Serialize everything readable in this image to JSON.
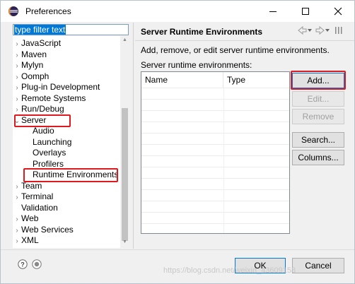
{
  "window": {
    "title": "Preferences",
    "app_icon": "eclipse-icon",
    "controls": [
      "minimize-icon",
      "maximize-icon",
      "close-icon"
    ]
  },
  "filter": {
    "value": "type filter text"
  },
  "tree": {
    "items": [
      {
        "label": "JavaScript",
        "arrow": "›",
        "indent": 0
      },
      {
        "label": "Maven",
        "arrow": "›",
        "indent": 0
      },
      {
        "label": "Mylyn",
        "arrow": "›",
        "indent": 0
      },
      {
        "label": "Oomph",
        "arrow": "›",
        "indent": 0
      },
      {
        "label": "Plug-in Development",
        "arrow": "›",
        "indent": 0
      },
      {
        "label": "Remote Systems",
        "arrow": "›",
        "indent": 0
      },
      {
        "label": "Run/Debug",
        "arrow": "›",
        "indent": 0
      },
      {
        "label": "Server",
        "arrow": "⌄",
        "indent": 0
      },
      {
        "label": "Audio",
        "arrow": "",
        "indent": 1
      },
      {
        "label": "Launching",
        "arrow": "",
        "indent": 1
      },
      {
        "label": "Overlays",
        "arrow": "",
        "indent": 1
      },
      {
        "label": "Profilers",
        "arrow": "",
        "indent": 1
      },
      {
        "label": "Runtime Environments",
        "arrow": "",
        "indent": 1
      },
      {
        "label": "Team",
        "arrow": "›",
        "indent": 0
      },
      {
        "label": "Terminal",
        "arrow": "›",
        "indent": 0
      },
      {
        "label": "Validation",
        "arrow": "",
        "indent": 0
      },
      {
        "label": "Web",
        "arrow": "›",
        "indent": 0
      },
      {
        "label": "Web Services",
        "arrow": "›",
        "indent": 0
      },
      {
        "label": "XML",
        "arrow": "›",
        "indent": 0
      }
    ]
  },
  "page": {
    "title": "Server Runtime Environments",
    "nav_icons": [
      "back-arrow-icon",
      "dropdown-icon",
      "forward-arrow-icon",
      "dropdown-icon",
      "view-menu-icon"
    ],
    "description": "Add, remove, or edit server runtime environments.",
    "list_label": "Server runtime environments:",
    "columns": [
      "Name",
      "Type"
    ],
    "rows": []
  },
  "buttons": {
    "add": "Add...",
    "edit": "Edit...",
    "remove": "Remove",
    "search": "Search...",
    "columns": "Columns..."
  },
  "footer": {
    "help_icon": "help-icon",
    "record_icon": "record-icon",
    "ok": "OK",
    "cancel": "Cancel"
  },
  "watermark": "https://blog.csdn.net/weixin_43609158",
  "highlight_color": "#e0191e",
  "selection_color": "#0078d7"
}
